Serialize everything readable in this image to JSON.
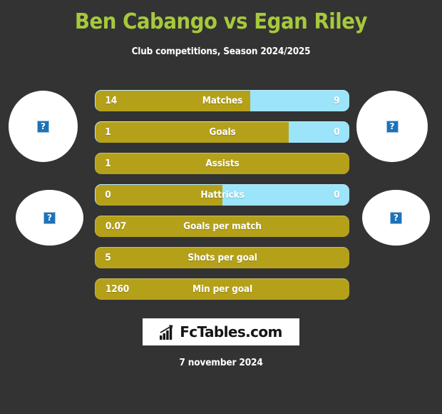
{
  "header": {
    "title": "Ben Cabango vs Egan Riley",
    "subtitle": "Club competitions, Season 2024/2025",
    "title_color": "#a6c93c"
  },
  "colors": {
    "background": "#333333",
    "home_bar": "#b5a119",
    "away_bar": "#9ce4fa",
    "title": "#a6c93c",
    "text": "#ffffff",
    "placeholder_icon": "#1e72b8"
  },
  "avatars": [
    {
      "name": "home-player-photo-top",
      "icon": "broken-image-icon",
      "glyph": "?"
    },
    {
      "name": "home-player-photo-bottom",
      "icon": "broken-image-icon",
      "glyph": "?"
    },
    {
      "name": "away-player-photo-top",
      "icon": "broken-image-icon",
      "glyph": "?"
    },
    {
      "name": "away-player-photo-bottom",
      "icon": "broken-image-icon",
      "glyph": "?"
    }
  ],
  "stats": [
    {
      "label": "Matches",
      "home": "14",
      "away": "9",
      "home_pct": 61,
      "split": true
    },
    {
      "label": "Goals",
      "home": "1",
      "away": "0",
      "home_pct": 76,
      "split": true
    },
    {
      "label": "Assists",
      "home": "1",
      "away": "",
      "home_pct": 100,
      "split": false
    },
    {
      "label": "Hattricks",
      "home": "0",
      "away": "0",
      "home_pct": 50,
      "split": true
    },
    {
      "label": "Goals per match",
      "home": "0.07",
      "away": "",
      "home_pct": 100,
      "split": false
    },
    {
      "label": "Shots per goal",
      "home": "5",
      "away": "",
      "home_pct": 100,
      "split": false
    },
    {
      "label": "Min per goal",
      "home": "1260",
      "away": "",
      "home_pct": 100,
      "split": false
    }
  ],
  "footer": {
    "logo_text": "FcTables.com",
    "logo_icon": "bar-chart-growth-icon",
    "date": "7 november 2024"
  }
}
